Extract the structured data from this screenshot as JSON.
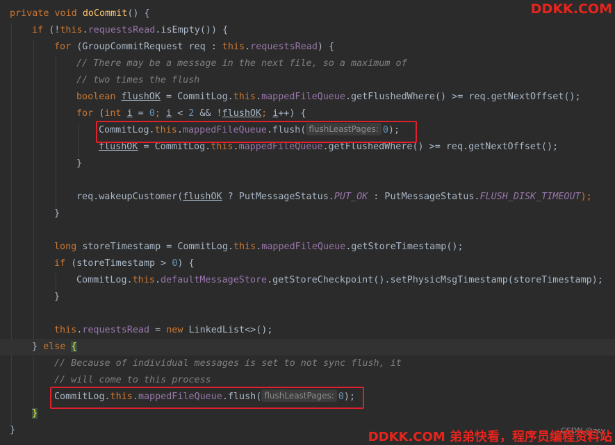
{
  "watermarks": {
    "top": "DDKK.COM",
    "bottom": "DDKK.COM 弟弟快看，程序员编程资料站",
    "csdn": "CSDN @zsy"
  },
  "hints": {
    "flush_param": "flushLeastPages:"
  },
  "code": {
    "l1_kw": "private void ",
    "l1_fn": "doCommit",
    "l1_rest": "() {",
    "l2_kw": "if ",
    "l2_a": "(!",
    "l2_this": "this",
    "l2_dot": ".",
    "l2_fld": "requestsRead",
    "l2_rest": ".isEmpty()) {",
    "l3_kw": "for ",
    "l3_a": "(GroupCommitRequest req : ",
    "l3_this": "this",
    "l3_dot": ".",
    "l3_fld": "requestsRead",
    "l3_rest": ") {",
    "l4": "// There may be a message in the next file, so a maximum of",
    "l5": "// two times the flush",
    "l6_kw": "boolean ",
    "l6_var": "flushOK",
    "l6_a": " = CommitLog.",
    "l6_this": "this",
    "l6_dot": ".",
    "l6_fld": "mappedFileQueue",
    "l6_rest": ".getFlushedWhere() >= req.getNextOffset();",
    "l7_kw": "for ",
    "l7_a": "(",
    "l7_int": "int ",
    "l7_i1": "i",
    "l7_b": " = ",
    "l7_z": "0",
    "l7_semi1": "; ",
    "l7_i2": "i",
    "l7_c": " < ",
    "l7_two": "2",
    "l7_d": " && !",
    "l7_fok": "flushOK",
    "l7_semi2": "; ",
    "l7_i3": "i",
    "l7_e": "++) {",
    "l8_a": "CommitLog.",
    "l8_this": "this",
    "l8_dot": ".",
    "l8_fld": "mappedFileQueue",
    "l8_b": ".flush(",
    "l8_num": "0",
    "l8_c": ");",
    "l9_var": "flushOK",
    "l9_a": " = CommitLog.",
    "l9_this": "this",
    "l9_dot": ".",
    "l9_fld": "mappedFileQueue",
    "l9_rest": ".getFlushedWhere() >= req.getNextOffset();",
    "l10": "}",
    "l11_a": "req.wakeupCustomer(",
    "l11_var": "flushOK",
    "l11_b": " ? PutMessageStatus.",
    "l11_c1": "PUT_OK",
    "l11_c": " : PutMessageStatus.",
    "l11_c2": "FLUSH_DISK_TIMEOUT",
    "l11_d": ");",
    "l12": "}",
    "l13_kw": "long ",
    "l13_a": "storeTimestamp = CommitLog.",
    "l13_this": "this",
    "l13_dot": ".",
    "l13_fld": "mappedFileQueue",
    "l13_rest": ".getStoreTimestamp();",
    "l14_kw": "if ",
    "l14_a": "(storeTimestamp > ",
    "l14_num": "0",
    "l14_b": ") {",
    "l15_a": "CommitLog.",
    "l15_this": "this",
    "l15_dot": ".",
    "l15_fld": "defaultMessageStore",
    "l15_rest": ".getStoreCheckpoint().setPhysicMsgTimestamp(storeTimestamp);",
    "l16": "}",
    "l17_this": "this",
    "l17_dot": ".",
    "l17_fld": "requestsRead",
    "l17_a": " = ",
    "l17_kw": "new ",
    "l17_rest": "LinkedList<>();",
    "l18_a": "} ",
    "l18_kw": "else ",
    "l18_br": "{",
    "l19": "// Because of individual messages is set to not sync flush, it",
    "l20": "// will come to this process",
    "l21_a": "CommitLog.",
    "l21_this": "this",
    "l21_dot": ".",
    "l21_fld": "mappedFileQueue",
    "l21_b": ".flush(",
    "l21_num": "0",
    "l21_c": ");",
    "l22_br": "}",
    "l23": "}"
  }
}
